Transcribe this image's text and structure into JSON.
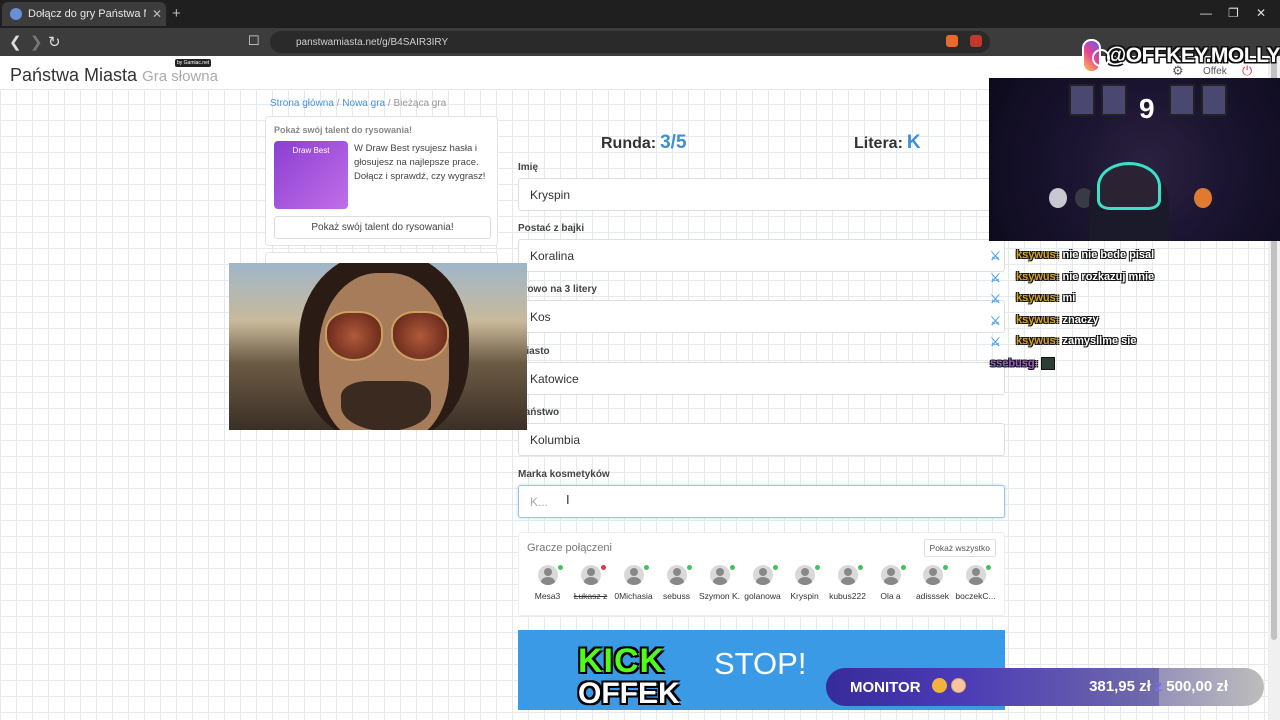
{
  "browser": {
    "tab_title": "Dołącz do gry Państwa Miasta",
    "url": "panstwamiasta.net/g/B4SAIR3IRY"
  },
  "header": {
    "brand": "Państwa Miasta",
    "brand_sub": "Gra słowna",
    "byline": "by Gamiac.net",
    "user": "Offek"
  },
  "breadcrumb": {
    "home": "Strona główna",
    "new_game": "Nowa gra",
    "current": "Bieżąca gra"
  },
  "ad": {
    "title": "Pokaż swój talent do rysowania!",
    "image_title": "Draw Best",
    "text": "W Draw Best rysujesz hasła i głosujesz na najlepsze prace. Dołącz i sprawdź, czy wygrasz!",
    "button": "Pokaż swój talent do rysowania!"
  },
  "game": {
    "round_label": "Runda:",
    "round_value": "3/5",
    "letter_label": "Litera:",
    "letter_value": "K",
    "fields": [
      {
        "label": "Imię",
        "value": "Kryspin"
      },
      {
        "label": "Postać z bajki",
        "value": "Koralina"
      },
      {
        "label": "Słowo na 3 litery",
        "value": "Kos"
      },
      {
        "label": "Miasto",
        "value": "Katowice"
      },
      {
        "label": "Państwo",
        "value": "Kolumbia"
      },
      {
        "label": "Marka kosmetyków",
        "value": "",
        "placeholder": "K..."
      }
    ],
    "stop": "STOP!"
  },
  "players": {
    "title": "Gracze połączeni",
    "show_all": "Pokaż wszystko",
    "list": [
      {
        "name": "Mesa3",
        "status": "online"
      },
      {
        "name": "Łukasz z",
        "status": "away"
      },
      {
        "name": "0Michasia",
        "status": "online"
      },
      {
        "name": "sebuss",
        "status": "online"
      },
      {
        "name": "Szymon K.",
        "status": "online"
      },
      {
        "name": "golanowa",
        "status": "online"
      },
      {
        "name": "Kryspin",
        "status": "online"
      },
      {
        "name": "kubus222",
        "status": "online"
      },
      {
        "name": "Ola a",
        "status": "online"
      },
      {
        "name": "adisssek",
        "status": "online"
      },
      {
        "name": "boczekC...",
        "status": "online"
      }
    ]
  },
  "overlay": {
    "instagram": "@OFFKEY.MOLLY",
    "webcam_counter": "9",
    "chat": [
      {
        "user": "ksywus",
        "msg": "nie nie bede pisal",
        "color": "#d4a020"
      },
      {
        "user": "ksywus",
        "msg": "nie rozkazuj mnie",
        "color": "#d4a020"
      },
      {
        "user": "ksywus",
        "msg": "mi",
        "color": "#d4a020"
      },
      {
        "user": "ksywus",
        "msg": "znaczy",
        "color": "#d4a020"
      },
      {
        "user": "ksywus",
        "msg": "zamysllme sie",
        "color": "#d4a020"
      },
      {
        "user": "ssebusg",
        "msg": "",
        "color": "#9b59d0"
      }
    ],
    "kick_top": "KICK",
    "kick_bottom": "OFFEK",
    "goal": {
      "label": "MONITOR",
      "current": "381,95 zł",
      "sep": "z",
      "target": "500,00 zł",
      "progress": 0.76
    }
  },
  "colors": {
    "accent": "#3a8fd6",
    "stop_button": "#3a9ae6",
    "kick_green": "#53fc18"
  }
}
